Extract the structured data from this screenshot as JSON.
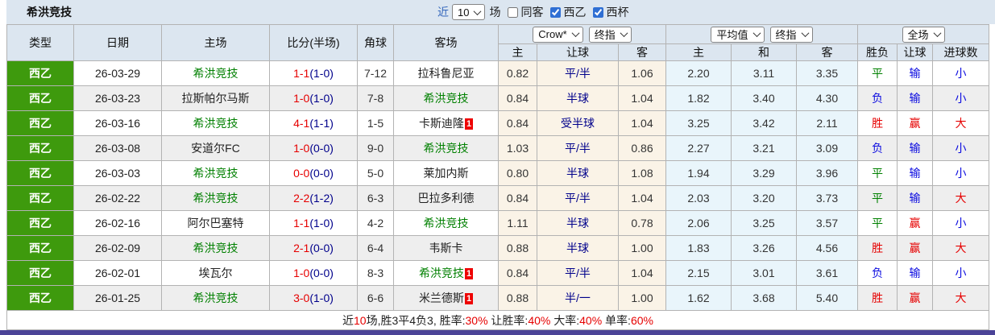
{
  "colors": {
    "header_bg": "#dce6f0",
    "league_green": "#3e9a0d",
    "team_green": "#008000",
    "score_red": "#e60000",
    "half_navy": "#00008b",
    "result_red": "#e60000",
    "result_blue": "#0b0be0",
    "result_green": "#008000",
    "odds_bg": "#faf3e7",
    "avg_bg": "#e9f5fb",
    "alt_row_bg": "#eeeeee",
    "bottom_bar": "#4b4397"
  },
  "header": {
    "title": "希洪竞技",
    "near_label": "近",
    "near_value": "10",
    "matches_label": "场",
    "checkboxes": [
      {
        "label": "同客",
        "checked": false
      },
      {
        "label": "西乙",
        "checked": true
      },
      {
        "label": "西杯",
        "checked": true
      }
    ]
  },
  "table": {
    "columns": {
      "type": "类型",
      "date": "日期",
      "home": "主场",
      "score": "比分(半场)",
      "corner": "角球",
      "away": "客场"
    },
    "selects": {
      "bookmaker": "Crow*",
      "handicap_time": "终指",
      "average": "平均值",
      "europe_time": "终指",
      "scope": "全场"
    },
    "sub_columns": {
      "home_odds": "主",
      "handicap": "让球",
      "away_odds": "客",
      "avg_home": "主",
      "avg_draw": "和",
      "avg_away": "客",
      "result": "胜负",
      "handicap_result": "让球",
      "goals": "进球数"
    }
  },
  "rows": [
    {
      "type": "西乙",
      "date": "26-03-29",
      "home": {
        "name": "希洪竞技",
        "cls": "team-self",
        "badge": ""
      },
      "score": "1-1",
      "half": "(1-0)",
      "corner": "7-12",
      "away": {
        "name": "拉科鲁尼亚",
        "cls": "",
        "badge": ""
      },
      "h_odds": "0.82",
      "handicap": "平/半",
      "a_odds": "1.06",
      "avg_h": "2.20",
      "avg_d": "3.11",
      "avg_a": "3.35",
      "res": "平",
      "res_c": "c-green",
      "hres": "输",
      "hres_c": "c-blue",
      "goal": "小",
      "goal_c": "c-blue"
    },
    {
      "type": "西乙",
      "date": "26-03-23",
      "home": {
        "name": "拉斯帕尔马斯",
        "cls": "",
        "badge": ""
      },
      "score": "1-0",
      "half": "(1-0)",
      "corner": "7-8",
      "away": {
        "name": "希洪竞技",
        "cls": "team-self",
        "badge": ""
      },
      "h_odds": "0.84",
      "handicap": "半球",
      "a_odds": "1.04",
      "avg_h": "1.82",
      "avg_d": "3.40",
      "avg_a": "4.30",
      "res": "负",
      "res_c": "c-blue",
      "hres": "输",
      "hres_c": "c-blue",
      "goal": "小",
      "goal_c": "c-blue"
    },
    {
      "type": "西乙",
      "date": "26-03-16",
      "home": {
        "name": "希洪竞技",
        "cls": "team-self",
        "badge": ""
      },
      "score": "4-1",
      "half": "(1-1)",
      "corner": "1-5",
      "away": {
        "name": "卡斯迪隆",
        "cls": "",
        "badge": "1"
      },
      "h_odds": "0.84",
      "handicap": "受半球",
      "a_odds": "1.04",
      "avg_h": "3.25",
      "avg_d": "3.42",
      "avg_a": "2.11",
      "res": "胜",
      "res_c": "c-red",
      "hres": "赢",
      "hres_c": "c-red",
      "goal": "大",
      "goal_c": "c-red"
    },
    {
      "type": "西乙",
      "date": "26-03-08",
      "home": {
        "name": "安道尔FC",
        "cls": "",
        "badge": ""
      },
      "score": "1-0",
      "half": "(0-0)",
      "corner": "9-0",
      "away": {
        "name": "希洪竞技",
        "cls": "team-self",
        "badge": ""
      },
      "h_odds": "1.03",
      "handicap": "平/半",
      "a_odds": "0.86",
      "avg_h": "2.27",
      "avg_d": "3.21",
      "avg_a": "3.09",
      "res": "负",
      "res_c": "c-blue",
      "hres": "输",
      "hres_c": "c-blue",
      "goal": "小",
      "goal_c": "c-blue"
    },
    {
      "type": "西乙",
      "date": "26-03-03",
      "home": {
        "name": "希洪竞技",
        "cls": "team-self",
        "badge": ""
      },
      "score": "0-0",
      "half": "(0-0)",
      "corner": "5-0",
      "away": {
        "name": "莱加内斯",
        "cls": "",
        "badge": ""
      },
      "h_odds": "0.80",
      "handicap": "半球",
      "a_odds": "1.08",
      "avg_h": "1.94",
      "avg_d": "3.29",
      "avg_a": "3.96",
      "res": "平",
      "res_c": "c-green",
      "hres": "输",
      "hres_c": "c-blue",
      "goal": "小",
      "goal_c": "c-blue"
    },
    {
      "type": "西乙",
      "date": "26-02-22",
      "home": {
        "name": "希洪竞技",
        "cls": "team-self",
        "badge": ""
      },
      "score": "2-2",
      "half": "(1-2)",
      "corner": "6-3",
      "away": {
        "name": "巴拉多利德",
        "cls": "",
        "badge": ""
      },
      "h_odds": "0.84",
      "handicap": "平/半",
      "a_odds": "1.04",
      "avg_h": "2.03",
      "avg_d": "3.20",
      "avg_a": "3.73",
      "res": "平",
      "res_c": "c-green",
      "hres": "输",
      "hres_c": "c-blue",
      "goal": "大",
      "goal_c": "c-red"
    },
    {
      "type": "西乙",
      "date": "26-02-16",
      "home": {
        "name": "阿尔巴塞特",
        "cls": "",
        "badge": ""
      },
      "score": "1-1",
      "half": "(1-0)",
      "corner": "4-2",
      "away": {
        "name": "希洪竞技",
        "cls": "team-self",
        "badge": ""
      },
      "h_odds": "1.11",
      "handicap": "半球",
      "a_odds": "0.78",
      "avg_h": "2.06",
      "avg_d": "3.25",
      "avg_a": "3.57",
      "res": "平",
      "res_c": "c-green",
      "hres": "赢",
      "hres_c": "c-red",
      "goal": "小",
      "goal_c": "c-blue"
    },
    {
      "type": "西乙",
      "date": "26-02-09",
      "home": {
        "name": "希洪竞技",
        "cls": "team-self",
        "badge": ""
      },
      "score": "2-1",
      "half": "(0-0)",
      "corner": "6-4",
      "away": {
        "name": "韦斯卡",
        "cls": "",
        "badge": ""
      },
      "h_odds": "0.88",
      "handicap": "半球",
      "a_odds": "1.00",
      "avg_h": "1.83",
      "avg_d": "3.26",
      "avg_a": "4.56",
      "res": "胜",
      "res_c": "c-red",
      "hres": "赢",
      "hres_c": "c-red",
      "goal": "大",
      "goal_c": "c-red"
    },
    {
      "type": "西乙",
      "date": "26-02-01",
      "home": {
        "name": "埃瓦尔",
        "cls": "",
        "badge": ""
      },
      "score": "1-0",
      "half": "(0-0)",
      "corner": "8-3",
      "away": {
        "name": "希洪竞技",
        "cls": "team-self",
        "badge": "1"
      },
      "h_odds": "0.84",
      "handicap": "平/半",
      "a_odds": "1.04",
      "avg_h": "2.15",
      "avg_d": "3.01",
      "avg_a": "3.61",
      "res": "负",
      "res_c": "c-blue",
      "hres": "输",
      "hres_c": "c-blue",
      "goal": "小",
      "goal_c": "c-blue"
    },
    {
      "type": "西乙",
      "date": "26-01-25",
      "home": {
        "name": "希洪竞技",
        "cls": "team-self",
        "badge": ""
      },
      "score": "3-0",
      "half": "(1-0)",
      "corner": "6-6",
      "away": {
        "name": "米兰德斯",
        "cls": "",
        "badge": "1"
      },
      "h_odds": "0.88",
      "handicap": "半/一",
      "a_odds": "1.00",
      "avg_h": "1.62",
      "avg_d": "3.68",
      "avg_a": "5.40",
      "res": "胜",
      "res_c": "c-red",
      "hres": "赢",
      "hres_c": "c-red",
      "goal": "大",
      "goal_c": "c-red"
    }
  ],
  "summary": {
    "parts": [
      "近",
      "10",
      "场,胜3平4负3, 胜率:",
      "30%",
      " 让胜率:",
      "40%",
      " 大率:",
      "40%",
      " 单率:",
      "60%"
    ]
  }
}
